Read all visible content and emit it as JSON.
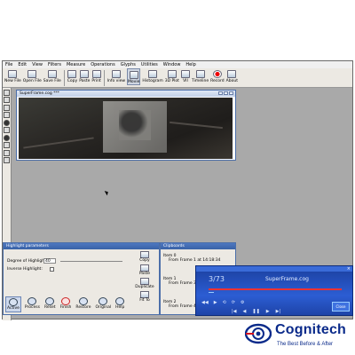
{
  "menu": [
    "File",
    "Edit",
    "View",
    "Filters",
    "Measure",
    "Operations",
    "Glyphs",
    "Utilities",
    "Window",
    "Help"
  ],
  "toolbar": [
    {
      "label": "New File",
      "icon": "new-file-icon"
    },
    {
      "label": "Open File",
      "icon": "open-folder-icon"
    },
    {
      "label": "Save File",
      "icon": "save-disk-icon"
    },
    {
      "label": "Copy",
      "icon": "copy-icon"
    },
    {
      "label": "Paste",
      "icon": "paste-icon"
    },
    {
      "label": "Print",
      "icon": "printer-icon"
    },
    {
      "label": "Info view",
      "icon": "info-icon"
    },
    {
      "label": "Movie",
      "icon": "movie-icon",
      "active": true
    },
    {
      "label": "Histogram",
      "icon": "histogram-icon"
    },
    {
      "label": "3D Plot",
      "icon": "plot-3d-icon"
    },
    {
      "label": "VII",
      "icon": "vii-icon"
    },
    {
      "label": "Timeline",
      "icon": "timeline-icon"
    },
    {
      "label": "Record",
      "icon": "record-icon"
    },
    {
      "label": "About",
      "icon": "about-icon"
    }
  ],
  "image_window": {
    "title": "SuperFrame.cog ***"
  },
  "highlight_panel": {
    "title": "Highlight parameters",
    "degree_label": "Degree of Highlight:",
    "degree_value": "40",
    "inverse_label": "Inverse Highlight:",
    "side_buttons": [
      "Copy",
      "Paste",
      "Duplicate",
      "Fit To"
    ],
    "bottom_buttons": [
      "Active",
      "Process",
      "Reset",
      "Finish",
      "Restore",
      "Original",
      "Help"
    ]
  },
  "clipboard": {
    "title": "Clipboards",
    "items": [
      {
        "name": "Item 0",
        "detail": "From Frame 1 at 14:18:34"
      },
      {
        "name": "Item 1",
        "detail": "From Frame 30"
      },
      {
        "name": "Item 2",
        "detail": "From Frame 45"
      }
    ]
  },
  "player": {
    "counter": "3/73",
    "filename": "SuperFrame.cog",
    "progress_fraction": 0.04,
    "close_label": "Close"
  },
  "brand": {
    "name": "Cognitech",
    "tagline": "The Best Before & After",
    "colors": {
      "primary": "#0a2a8a",
      "accent": "#d4101e"
    }
  }
}
